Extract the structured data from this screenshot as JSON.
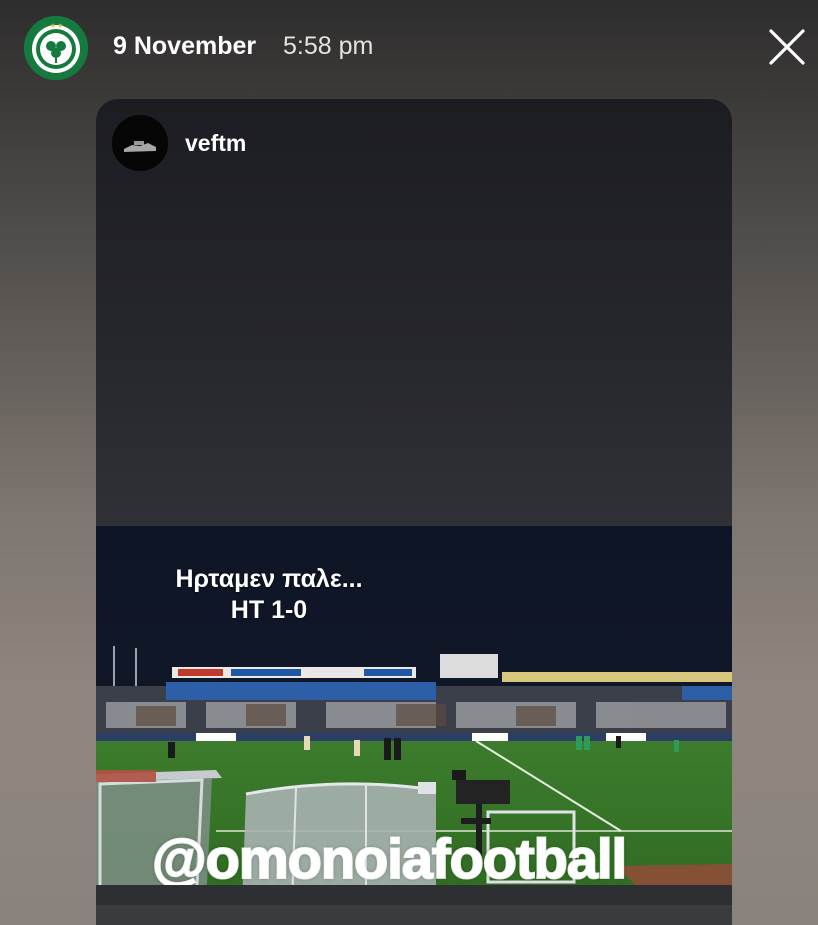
{
  "story": {
    "date": "9 November",
    "time": "5:58 pm"
  },
  "post": {
    "username": "veftm",
    "caption_line1": "Ηρταμεν παλε...",
    "caption_line2": "HT 1-0",
    "handle": "@omonoiafootball"
  },
  "icons": {
    "profile": "club-crest-icon",
    "close": "close-icon"
  },
  "colors": {
    "crest_green": "#157a3e",
    "pitch_green": "#3f8a2f",
    "text": "#ffffff"
  }
}
